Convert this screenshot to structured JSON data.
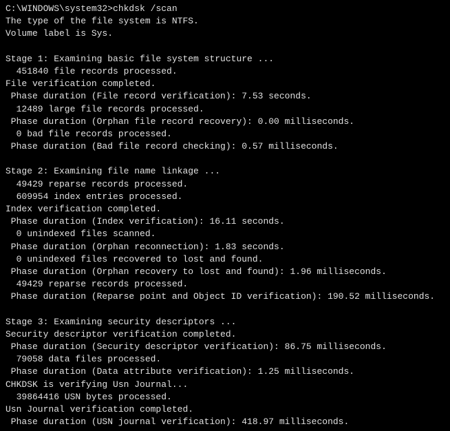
{
  "prompt": {
    "path": "C:\\WINDOWS\\system32>",
    "command": "chkdsk /scan"
  },
  "header": {
    "fs_type": "The type of the file system is NTFS.",
    "volume_label": "Volume label is Sys."
  },
  "stage1": {
    "title": "Stage 1: Examining basic file system structure ...",
    "file_records": "451840 file records processed.",
    "file_verif": "File verification completed.",
    "phase_file_record": "Phase duration (File record verification): 7.53 seconds.",
    "large_files": "12489 large file records processed.",
    "phase_orphan_recovery": "Phase duration (Orphan file record recovery): 0.00 milliseconds.",
    "bad_files": "0 bad file records processed.",
    "phase_bad_checking": "Phase duration (Bad file record checking): 0.57 milliseconds."
  },
  "stage2": {
    "title": "Stage 2: Examining file name linkage ...",
    "reparse_records": "49429 reparse records processed.",
    "index_entries": "609954 index entries processed.",
    "index_verif": "Index verification completed.",
    "phase_index": "Phase duration (Index verification): 16.11 seconds.",
    "unindexed": "0 unindexed files scanned.",
    "phase_orphan_reconn": "Phase duration (Orphan reconnection): 1.83 seconds.",
    "unindexed_recovered": "0 unindexed files recovered to lost and found.",
    "phase_orphan_lost": "Phase duration (Orphan recovery to lost and found): 1.96 milliseconds.",
    "reparse_records2": "49429 reparse records processed.",
    "phase_reparse": "Phase duration (Reparse point and Object ID verification): 190.52 milliseconds."
  },
  "stage3": {
    "title": "Stage 3: Examining security descriptors ...",
    "sec_verif": "Security descriptor verification completed.",
    "phase_sec": "Phase duration (Security descriptor verification): 86.75 milliseconds.",
    "data_files": "79058 data files processed.",
    "phase_data": "Phase duration (Data attribute verification): 1.25 milliseconds.",
    "usn_verif": "CHKDSK is verifying Usn Journal...",
    "usn_bytes": "39864416 USN bytes processed.",
    "usn_complete": "Usn Journal verification completed.",
    "phase_usn": "Phase duration (USN journal verification): 418.97 milliseconds."
  }
}
